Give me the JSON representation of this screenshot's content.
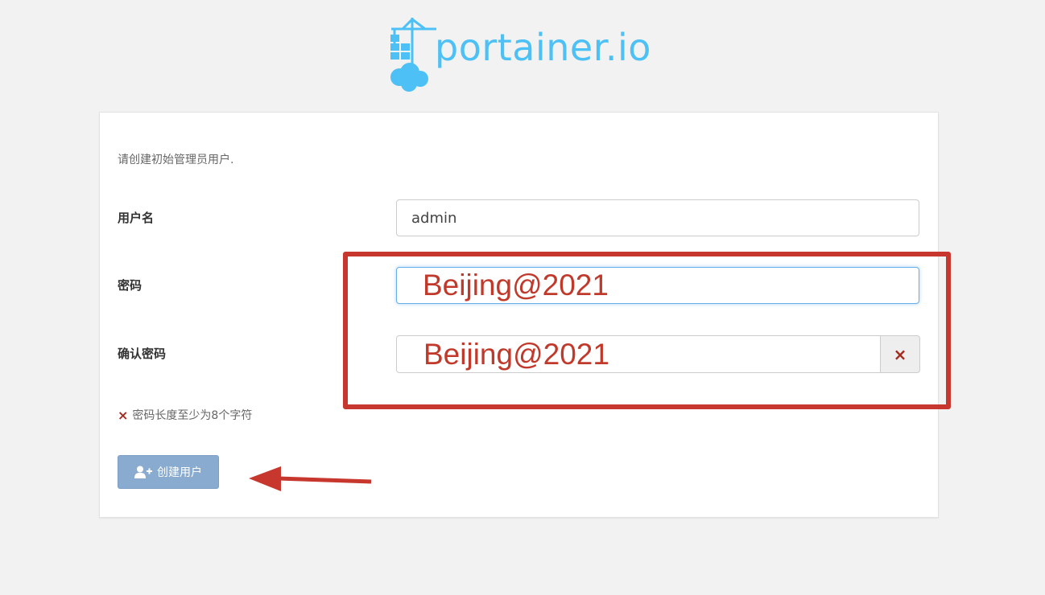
{
  "brand": {
    "logo_text": "portainer.io",
    "color": "#4dc1f5"
  },
  "form": {
    "intro": "请创建初始管理员用户.",
    "username_label": "用户名",
    "username_value": "admin",
    "password_label": "密码",
    "password_value": "Beijing@2021",
    "confirm_label": "确认密码",
    "confirm_value": "Beijing@2021",
    "mismatch_icon": "×",
    "validation_hint": "密码长度至少为8个字符",
    "submit_label": "创建用户",
    "submit_icon": "user-plus-icon"
  },
  "annotations": {
    "highlight_color": "#c8372d"
  }
}
